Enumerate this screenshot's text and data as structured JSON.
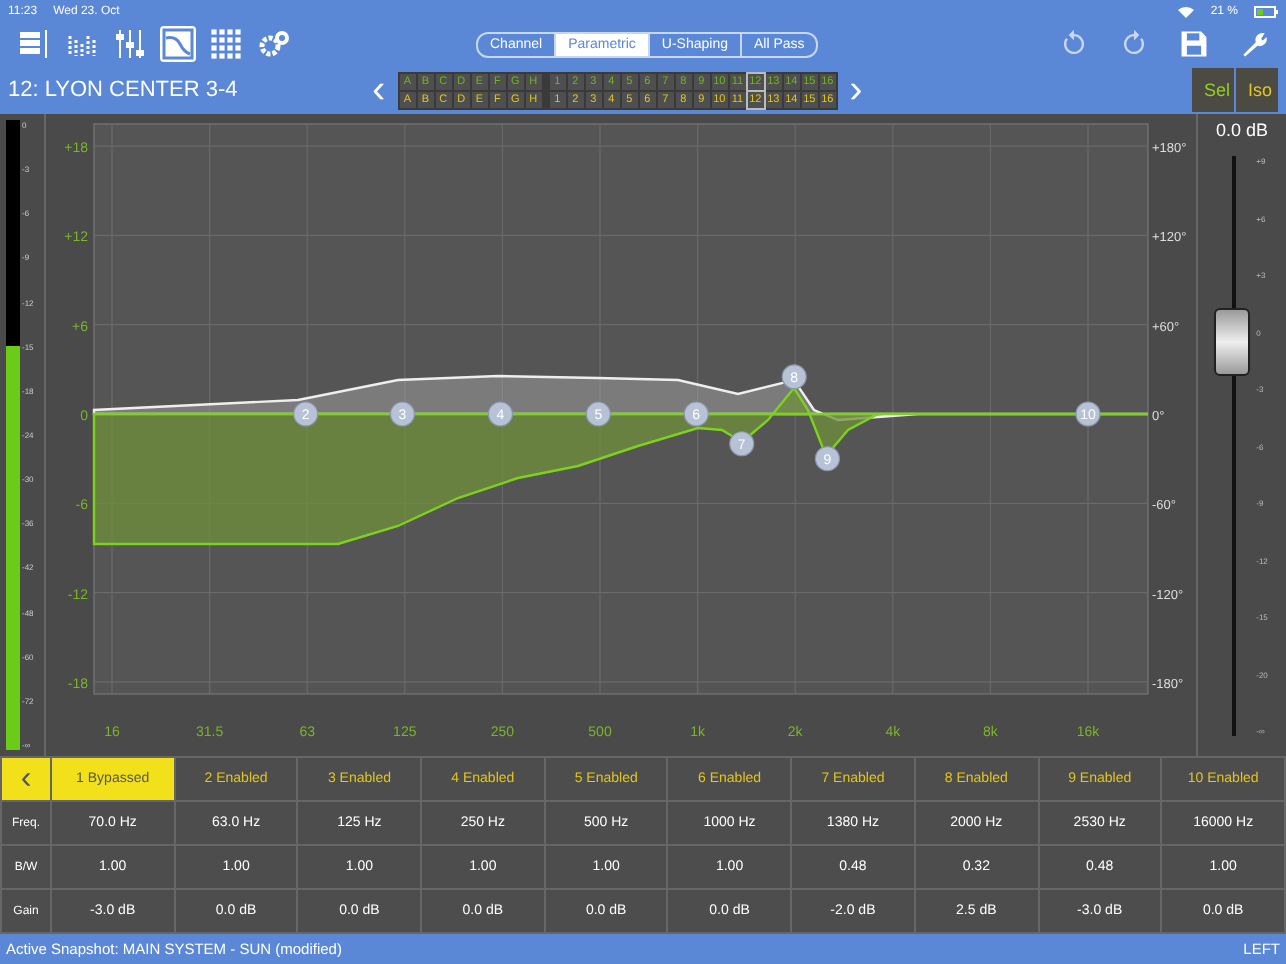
{
  "status_bar": {
    "time": "11:23",
    "date": "Wed 23. Oct",
    "battery": "21 %"
  },
  "toolbar": {
    "views": [
      {
        "kind": "rack",
        "selected": false
      },
      {
        "kind": "meters",
        "selected": false
      },
      {
        "kind": "faders",
        "selected": false
      },
      {
        "kind": "eq",
        "selected": true
      },
      {
        "kind": "grid",
        "selected": false
      },
      {
        "kind": "gears",
        "selected": false
      }
    ],
    "tabs": [
      {
        "label": "Channel",
        "selected": false
      },
      {
        "label": "Parametric",
        "selected": true
      },
      {
        "label": "U-Shaping",
        "selected": false
      },
      {
        "label": "All Pass",
        "selected": false
      }
    ],
    "actions": [
      {
        "kind": "undo"
      },
      {
        "kind": "redo"
      },
      {
        "kind": "save"
      },
      {
        "kind": "wrench"
      }
    ]
  },
  "channel": {
    "title": "12: LYON CENTER 3-4",
    "prev": "‹",
    "next": "›",
    "grid_rows": [
      {
        "kind": "source",
        "cells": [
          {
            "label": "A",
            "selected": false
          },
          {
            "label": "B",
            "selected": false
          },
          {
            "label": "C",
            "selected": false
          },
          {
            "label": "D",
            "selected": false
          },
          {
            "label": "E",
            "selected": false
          },
          {
            "label": "F",
            "selected": false
          },
          {
            "label": "G",
            "selected": false
          },
          {
            "label": "H",
            "selected": false
          },
          {
            "label": "1",
            "selected": false
          },
          {
            "label": "2",
            "selected": false
          },
          {
            "label": "3",
            "selected": false
          },
          {
            "label": "4",
            "selected": false
          },
          {
            "label": "5",
            "selected": false
          },
          {
            "label": "6",
            "selected": false
          },
          {
            "label": "7",
            "selected": false
          },
          {
            "label": "8",
            "selected": false
          },
          {
            "label": "9",
            "selected": false
          },
          {
            "label": "10",
            "selected": false
          },
          {
            "label": "11",
            "selected": false
          },
          {
            "label": "12",
            "selected": true
          },
          {
            "label": "13",
            "selected": false
          },
          {
            "label": "14",
            "selected": false
          },
          {
            "label": "15",
            "selected": false
          },
          {
            "label": "16",
            "selected": false
          }
        ]
      },
      {
        "kind": "destination",
        "cells": [
          {
            "label": "A",
            "selected": false
          },
          {
            "label": "B",
            "selected": false
          },
          {
            "label": "C",
            "selected": false
          },
          {
            "label": "D",
            "selected": false
          },
          {
            "label": "E",
            "selected": false
          },
          {
            "label": "F",
            "selected": false
          },
          {
            "label": "G",
            "selected": false
          },
          {
            "label": "H",
            "selected": false
          },
          {
            "label": "1",
            "selected": false
          },
          {
            "label": "2",
            "selected": false
          },
          {
            "label": "3",
            "selected": false
          },
          {
            "label": "4",
            "selected": false
          },
          {
            "label": "5",
            "selected": false
          },
          {
            "label": "6",
            "selected": false
          },
          {
            "label": "7",
            "selected": false
          },
          {
            "label": "8",
            "selected": false
          },
          {
            "label": "9",
            "selected": false
          },
          {
            "label": "10",
            "selected": false
          },
          {
            "label": "11",
            "selected": false
          },
          {
            "label": "12",
            "selected": true
          },
          {
            "label": "13",
            "selected": false
          },
          {
            "label": "14",
            "selected": false
          },
          {
            "label": "15",
            "selected": false
          },
          {
            "label": "16",
            "selected": false
          }
        ]
      }
    ],
    "sel": "Sel",
    "iso": "Iso"
  },
  "meter": {
    "level": 0.64,
    "scale": [
      "0",
      "-3",
      "-6",
      "-9",
      "-12",
      "-15",
      "-18",
      "-24",
      "-30",
      "-36",
      "-42",
      "-48",
      "-60",
      "-72",
      "-∞"
    ]
  },
  "graph": {
    "db_labels": [
      "+18",
      "+12",
      "+6",
      "0",
      "-6",
      "-12",
      "-18"
    ],
    "phase_labels": [
      "+180°",
      "+120°",
      "+60°",
      "0°",
      "-60°",
      "-120°",
      "-180°"
    ],
    "freq_labels": [
      "16",
      "31.5",
      "63",
      "125",
      "250",
      "500",
      "1k",
      "2k",
      "4k",
      "8k",
      "16k"
    ]
  },
  "fader": {
    "reading": "0.0 dB",
    "level": 0.68,
    "scale": [
      "+9",
      "+6",
      "+3",
      "0",
      "-3",
      "-6",
      "-9",
      "-12",
      "-15",
      "-20",
      "-∞"
    ]
  },
  "table": {
    "back": "‹",
    "row_labels": [
      "Freq.",
      "B/W",
      "Gain"
    ],
    "bands": [
      {
        "header": "1 Bypassed",
        "bypassed": true,
        "freq": "70.0 Hz",
        "bw": "1.00",
        "gain": "-3.0 dB"
      },
      {
        "header": "2 Enabled",
        "bypassed": false,
        "node": "2",
        "freq": "63.0 Hz",
        "bw": "1.00",
        "gain": "0.0 dB"
      },
      {
        "header": "3 Enabled",
        "bypassed": false,
        "node": "3",
        "freq": "125 Hz",
        "bw": "1.00",
        "gain": "0.0 dB"
      },
      {
        "header": "4 Enabled",
        "bypassed": false,
        "node": "4",
        "freq": "250 Hz",
        "bw": "1.00",
        "gain": "0.0 dB"
      },
      {
        "header": "5 Enabled",
        "bypassed": false,
        "node": "5",
        "freq": "500 Hz",
        "bw": "1.00",
        "gain": "0.0 dB"
      },
      {
        "header": "6 Enabled",
        "bypassed": false,
        "node": "6",
        "freq": "1000 Hz",
        "bw": "1.00",
        "gain": "0.0 dB"
      },
      {
        "header": "7 Enabled",
        "bypassed": false,
        "node": "7",
        "freq": "1380 Hz",
        "bw": "0.48",
        "gain": "-2.0 dB"
      },
      {
        "header": "8 Enabled",
        "bypassed": false,
        "node": "8",
        "freq": "2000 Hz",
        "bw": "0.32",
        "gain": "2.5 dB"
      },
      {
        "header": "9 Enabled",
        "bypassed": false,
        "node": "9",
        "freq": "2530 Hz",
        "bw": "0.48",
        "gain": "-3.0 dB"
      },
      {
        "header": "10 Enabled",
        "bypassed": false,
        "node": "10",
        "freq": "16000 Hz",
        "bw": "1.00",
        "gain": "0.0 dB"
      }
    ]
  },
  "footer": {
    "snapshot": "Active Snapshot: MAIN SYSTEM - SUN (modified)",
    "side": "LEFT"
  }
}
